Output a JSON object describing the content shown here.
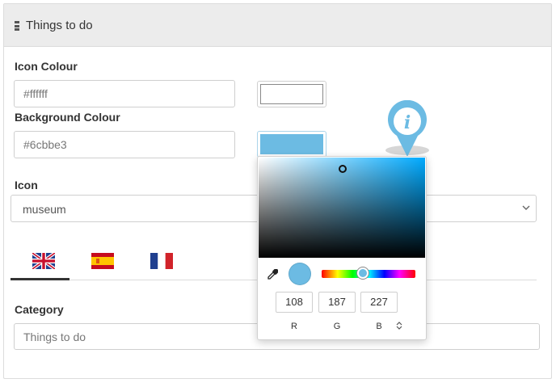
{
  "panel": {
    "title": "Things to do"
  },
  "icon_colour": {
    "label": "Icon Colour",
    "value": "#ffffff",
    "swatch": "#ffffff"
  },
  "background_colour": {
    "label": "Background Colour",
    "value": "#6cbbe3",
    "swatch": "#6cbbe3"
  },
  "icon": {
    "label": "Icon",
    "selected": "museum"
  },
  "language_tabs": [
    {
      "lang": "English",
      "flag": "uk-flag-icon",
      "active": true
    },
    {
      "lang": "Spanish",
      "flag": "spain-flag-icon",
      "active": false
    },
    {
      "lang": "French",
      "flag": "france-flag-icon",
      "active": false
    }
  ],
  "category": {
    "label": "Category",
    "placeholder": "Things to do"
  },
  "color_picker": {
    "r": "108",
    "g": "187",
    "b": "227",
    "labels": {
      "r": "R",
      "g": "G",
      "b": "B"
    },
    "preview_color": "#6cbbe3"
  },
  "marker": {
    "color": "#6cbbe3",
    "icon": "info-icon",
    "glyph": "i"
  }
}
